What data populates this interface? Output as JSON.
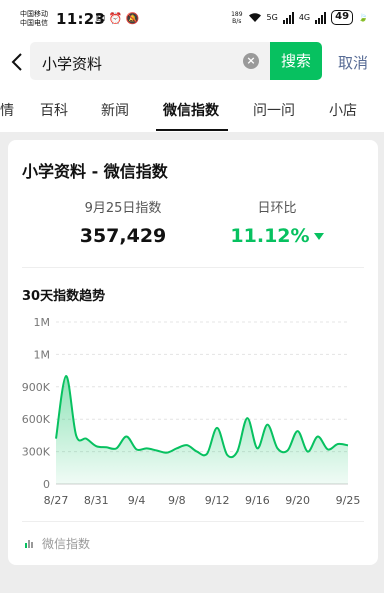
{
  "status_bar": {
    "carrier_1": "中国移动",
    "carrier_2": "中国电信",
    "time": "11:23",
    "net_speed_value": "189",
    "net_speed_unit": "B/s",
    "net_1": "5G",
    "net_2": "4G",
    "battery": "49",
    "icons": [
      "message-icon",
      "alarm-icon",
      "mute-icon",
      "wifi-icon",
      "signal-icon",
      "battery-icon"
    ]
  },
  "search": {
    "query": "小学资料",
    "button_label": "搜索",
    "cancel_label": "取消"
  },
  "tabs": [
    {
      "label": "情",
      "active": false
    },
    {
      "label": "百科",
      "active": false
    },
    {
      "label": "新闻",
      "active": false
    },
    {
      "label": "微信指数",
      "active": true
    },
    {
      "label": "问一问",
      "active": false
    },
    {
      "label": "小店",
      "active": false
    }
  ],
  "card": {
    "title": "小学资料 - 微信指数",
    "stat_date_label": "9月25日指数",
    "stat_value": "357,429",
    "stat_change_label": "日环比",
    "stat_change_value": "11.12%",
    "chart_heading": "30天指数趋势",
    "footer_label": "微信指数"
  },
  "colors": {
    "accent": "#07c160",
    "link": "#576b95"
  },
  "chart_data": {
    "type": "area",
    "title": "30天指数趋势",
    "x": [
      "8/27",
      "8/28",
      "8/29",
      "8/30",
      "8/31",
      "9/1",
      "9/2",
      "9/3",
      "9/4",
      "9/5",
      "9/6",
      "9/7",
      "9/8",
      "9/9",
      "9/10",
      "9/11",
      "9/12",
      "9/13",
      "9/14",
      "9/15",
      "9/16",
      "9/17",
      "9/18",
      "9/19",
      "9/20",
      "9/21",
      "9/22",
      "9/23",
      "9/24",
      "9/25"
    ],
    "values": [
      420000,
      1000000,
      450000,
      420000,
      350000,
      340000,
      330000,
      440000,
      320000,
      330000,
      310000,
      290000,
      330000,
      360000,
      300000,
      280000,
      520000,
      270000,
      300000,
      610000,
      330000,
      550000,
      330000,
      310000,
      490000,
      300000,
      440000,
      320000,
      370000,
      357429
    ],
    "x_tick_labels": [
      "8/27",
      "8/31",
      "9/4",
      "9/8",
      "9/12",
      "9/16",
      "9/20",
      "9/25"
    ],
    "y_tick_labels": [
      "0",
      "300K",
      "600K",
      "900K",
      "1M",
      "1M"
    ],
    "y_tick_values": [
      0,
      300000,
      600000,
      900000,
      1200000,
      1500000
    ],
    "ylim": [
      0,
      1500000
    ],
    "grid": true,
    "legend": "none"
  }
}
